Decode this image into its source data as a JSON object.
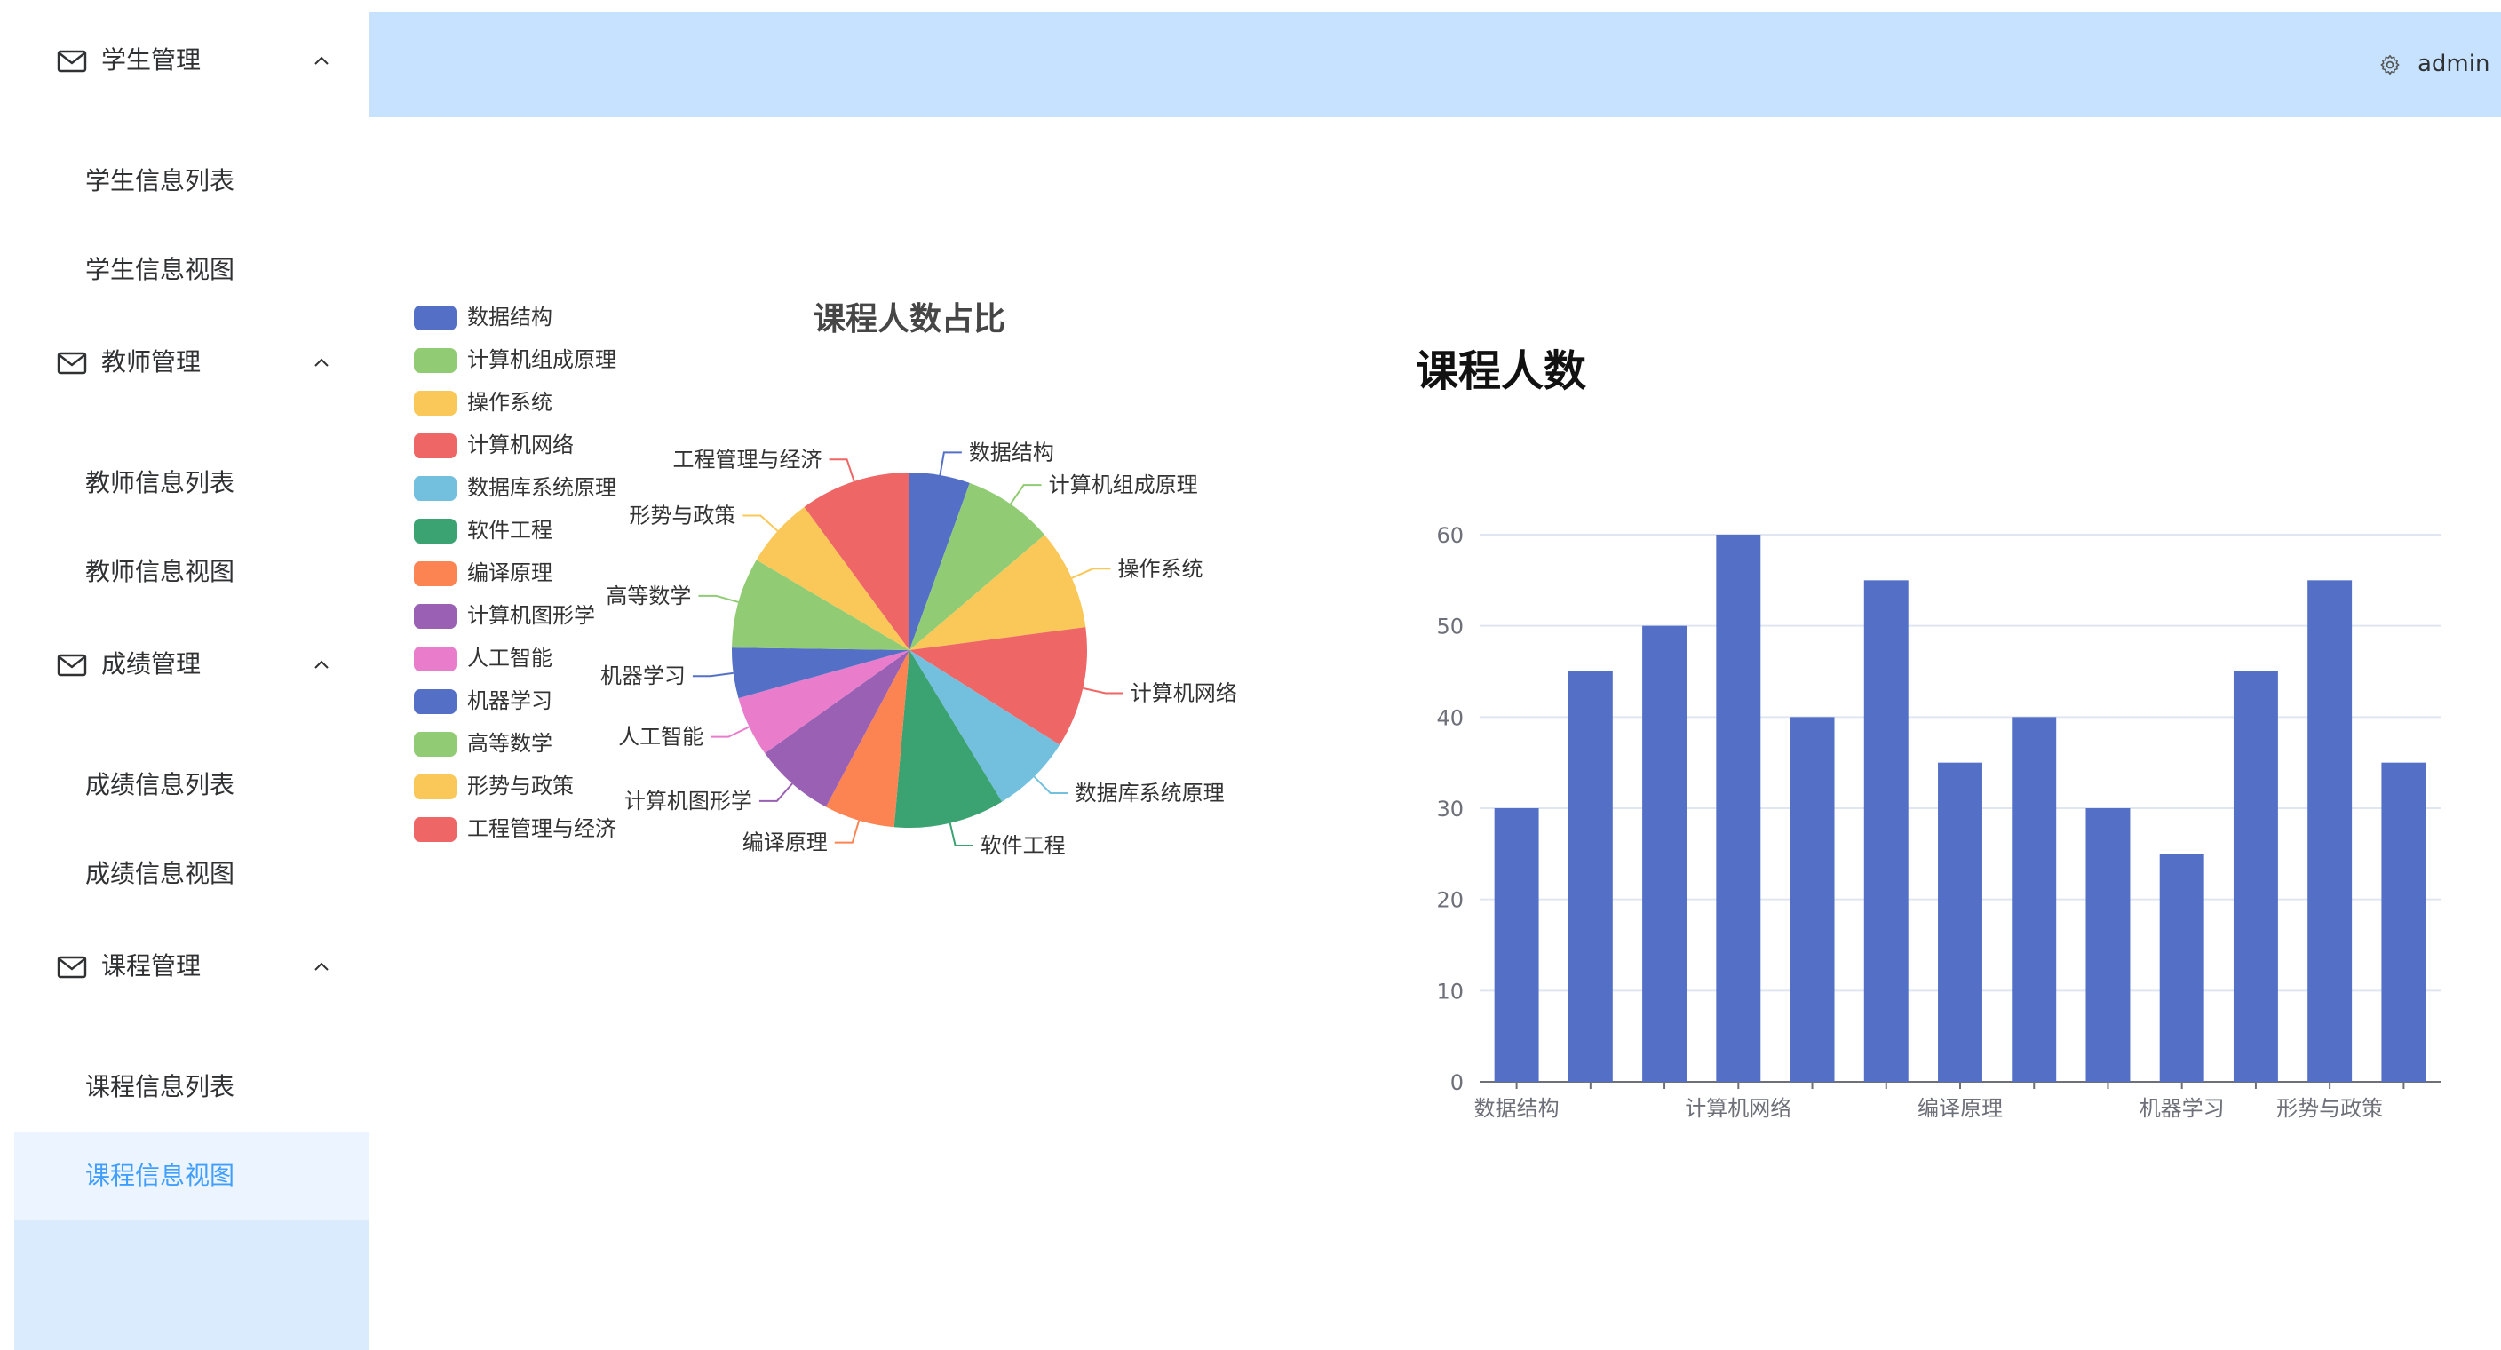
{
  "header": {
    "username": "admin",
    "settings_icon": "gear-icon"
  },
  "sidebar": {
    "groups": [
      {
        "label": "学生管理",
        "icon": "mail-icon",
        "items": [
          "学生信息列表",
          "学生信息视图"
        ]
      },
      {
        "label": "教师管理",
        "icon": "mail-icon",
        "items": [
          "教师信息列表",
          "教师信息视图"
        ]
      },
      {
        "label": "成绩管理",
        "icon": "mail-icon",
        "items": [
          "成绩信息列表",
          "成绩信息视图"
        ]
      },
      {
        "label": "课程管理",
        "icon": "mail-icon",
        "items": [
          "课程信息列表",
          "课程信息视图"
        ]
      }
    ],
    "active_item": "课程信息视图",
    "active_color": "#409eff"
  },
  "chart_data": [
    {
      "type": "pie",
      "title": "课程人数占比",
      "legend_position": "left",
      "categories": [
        "数据结构",
        "计算机组成原理",
        "操作系统",
        "计算机网络",
        "数据库系统原理",
        "软件工程",
        "编译原理",
        "计算机图形学",
        "人工智能",
        "机器学习",
        "高等数学",
        "形势与政策",
        "工程管理与经济"
      ],
      "values": [
        30,
        45,
        50,
        60,
        40,
        55,
        35,
        40,
        30,
        25,
        45,
        35,
        55
      ],
      "colors": [
        "#5470c6",
        "#91cc75",
        "#fac858",
        "#ee6666",
        "#73c0de",
        "#3ba272",
        "#fc8452",
        "#9a60b4",
        "#ea7ccc",
        "#5470c6",
        "#91cc75",
        "#fac858",
        "#ee6666"
      ]
    },
    {
      "type": "bar",
      "title": "课程人数",
      "categories": [
        "数据结构",
        "计算机组成原理",
        "操作系统",
        "计算机网络",
        "数据库系统原理",
        "软件工程",
        "编译原理",
        "计算机图形学",
        "人工智能",
        "机器学习",
        "高等数学",
        "形势与政策",
        "工程管理与经济"
      ],
      "visible_x_tick_labels": [
        "数据结构",
        "计算机网络",
        "编译原理",
        "机器学习",
        "形势与政策"
      ],
      "values": [
        30,
        45,
        50,
        60,
        40,
        55,
        35,
        40,
        30,
        25,
        45,
        55,
        35
      ],
      "ylim": [
        0,
        60
      ],
      "y_ticks": [
        0,
        10,
        20,
        30,
        40,
        50,
        60
      ],
      "grid": true,
      "color": "#5470c6"
    }
  ]
}
